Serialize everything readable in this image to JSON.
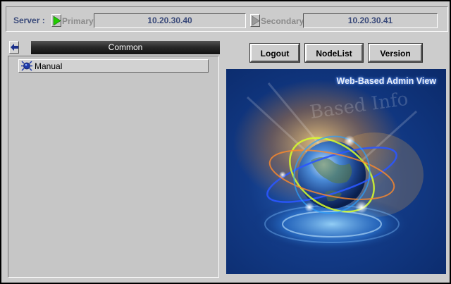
{
  "server_bar": {
    "label": "Server :",
    "primary": {
      "name": "Primary",
      "ip": "10.20.30.40"
    },
    "secondary": {
      "name": "Secondary",
      "ip": "10.20.30.41"
    }
  },
  "left_panel": {
    "tab_label": "Common",
    "items": [
      {
        "label": "Manual",
        "icon": "manual-icon"
      }
    ]
  },
  "toolbar": {
    "logout_label": "Logout",
    "nodelist_label": "NodeList",
    "version_label": "Version"
  },
  "splash": {
    "title": "Web-Based Admin View",
    "watermark_text": "Based Info"
  },
  "colors": {
    "background": "#cccccc",
    "label_blue": "#3a4a7a",
    "primary_indicator": "#22cc00",
    "secondary_indicator": "#888888",
    "tab_dark": "#1a1a1a",
    "splash_blue": "#123a86"
  }
}
